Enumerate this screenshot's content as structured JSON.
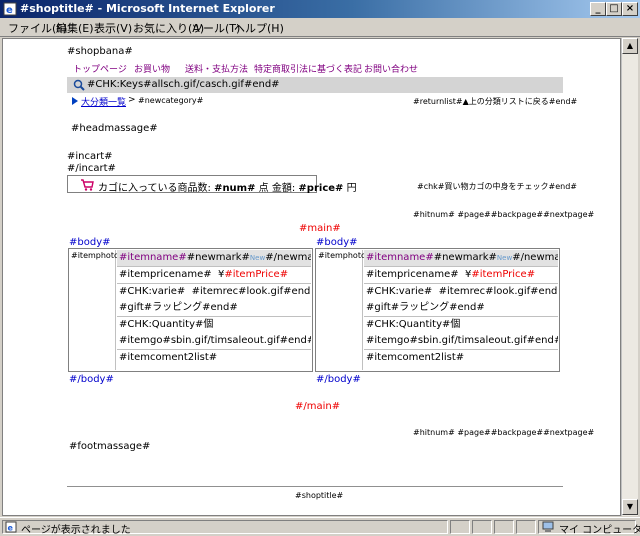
{
  "window": {
    "title": "#shoptitle# - Microsoft Internet Explorer",
    "min_label": "_",
    "max_label": "□",
    "close_label": "×"
  },
  "menu": [
    "ファイル(F)",
    "編集(E)",
    "表示(V)",
    "お気に入り(A)",
    "ツール(T)",
    "ヘルプ(H)"
  ],
  "page": {
    "shopbana": "#shopbana#",
    "nav": [
      "トップページ",
      "お買い物",
      "送料・支払方法",
      "特定商取引法に基づく表記",
      "お問い合わせ"
    ],
    "search_text": "#CHK:Keys#allsch.gif/casch.gif#end#",
    "breadcrumb_link": "大分類一覧",
    "breadcrumb_sep": ">",
    "breadcrumb_category": "#newcategory#",
    "returnlist": "#returnlist#▲上の分類リストに戻る#end#",
    "headmassage": "#headmassage#",
    "incart": "#incart#",
    "incart_end": "#/incart#",
    "cart_text_prefix": "カゴに入っている商品数:",
    "cart_num": "#num#",
    "cart_unit": "点",
    "cart_total_label": "金額:",
    "cart_price": "#price#",
    "cart_yen": "円",
    "chk_text": "#chk#買い物カゴの中身をチェック#end#",
    "pager": "#hitnum#  #page##backpage##nextpage#",
    "main_open": "#main#",
    "main_close": "#/main#",
    "body_open": "#body#",
    "body_close": "#/body#",
    "footmassage": "#footmassage#",
    "shoptitle": "#shoptitle#"
  },
  "items": [
    {
      "photo": "#itemphoto#",
      "name": "#itemname#",
      "newmark": "#newmark#",
      "new_badge": "New",
      "newmark_end": "#/newmark#",
      "pricename": "#itempricename#",
      "yen": "¥",
      "price": "#itemPrice#",
      "varie": "#CHK:varie#",
      "itemrec": "#itemrec#look.gif#end#",
      "gift": "#gift#ラッピング#end#",
      "quantity": "#CHK:Quantity#個",
      "itemgo": "#itemgo#sbin.gif/timsaleout.gif#end#",
      "comment": "#itemcoment2list#"
    },
    {
      "photo": "#itemphoto#",
      "name": "#itemname#",
      "newmark": "#newmark#",
      "new_badge": "New",
      "newmark_end": "#/newmark#",
      "pricename": "#itempricename#",
      "yen": "¥",
      "price": "#itemPrice#",
      "varie": "#CHK:varie#",
      "itemrec": "#itemrec#look.gif#end#",
      "gift": "#gift#ラッピング#end#",
      "quantity": "#CHK:Quantity#個",
      "itemgo": "#itemgo#sbin.gif/timsaleout.gif#end#",
      "comment": "#itemcoment2list#"
    }
  ],
  "status": {
    "text": "ページが表示されました",
    "zone": "マイ コンピュータ"
  }
}
